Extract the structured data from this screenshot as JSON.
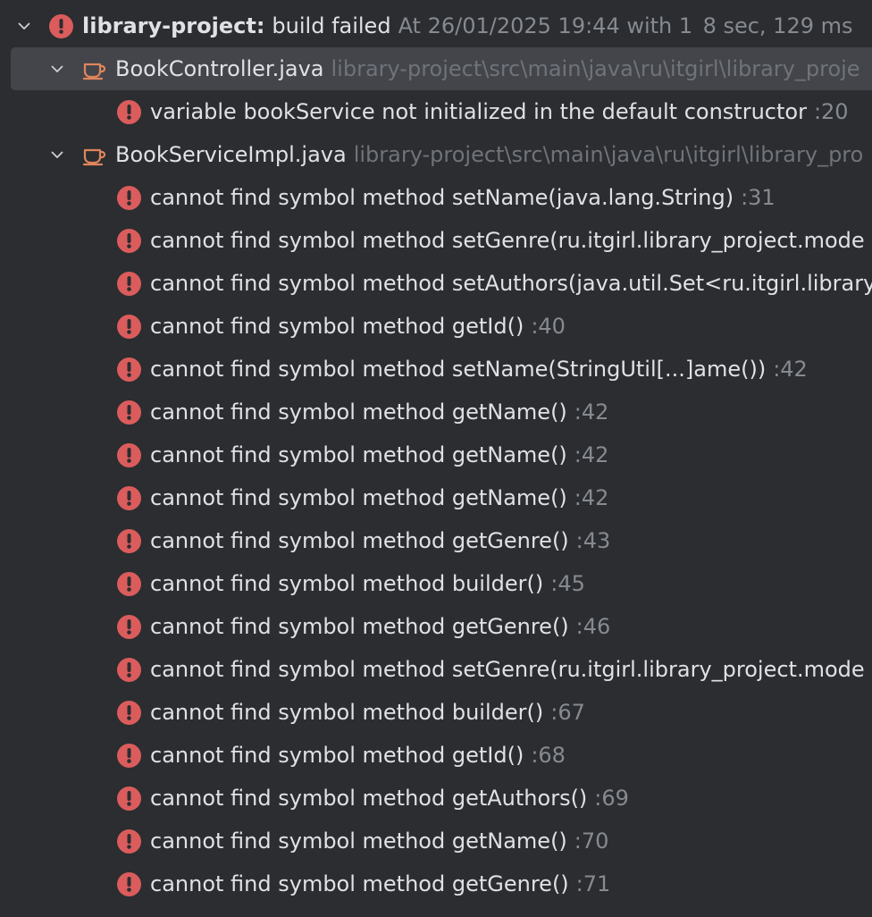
{
  "root": {
    "project": "library-project:",
    "status": "build failed",
    "detail": "At 26/01/2025 19:44 with 1",
    "duration": "8 sec, 129 ms"
  },
  "files": [
    {
      "name": "BookController.java",
      "path": "library-project\\src\\main\\java\\ru\\itgirl\\library_proje",
      "errors": [
        {
          "message": "variable bookService not initialized in the default constructor",
          "line": ":20"
        }
      ]
    },
    {
      "name": "BookServiceImpl.java",
      "path": "library-project\\src\\main\\java\\ru\\itgirl\\library_pro",
      "errors": [
        {
          "message": "cannot find symbol method setName(java.lang.String)",
          "line": ":31"
        },
        {
          "message": "cannot find symbol method setGenre(ru.itgirl.library_project.mode",
          "line": ""
        },
        {
          "message": "cannot find symbol method setAuthors(java.util.Set<ru.itgirl.library",
          "line": ""
        },
        {
          "message": "cannot find symbol method getId()",
          "line": ":40"
        },
        {
          "message": "cannot find symbol method setName(StringUtil[...]ame())",
          "line": ":42"
        },
        {
          "message": "cannot find symbol method getName()",
          "line": ":42"
        },
        {
          "message": "cannot find symbol method getName()",
          "line": ":42"
        },
        {
          "message": "cannot find symbol method getName()",
          "line": ":42"
        },
        {
          "message": "cannot find symbol method getGenre()",
          "line": ":43"
        },
        {
          "message": "cannot find symbol method builder()",
          "line": ":45"
        },
        {
          "message": "cannot find symbol method getGenre()",
          "line": ":46"
        },
        {
          "message": "cannot find symbol method setGenre(ru.itgirl.library_project.mode",
          "line": ""
        },
        {
          "message": "cannot find symbol method builder()",
          "line": ":67"
        },
        {
          "message": "cannot find symbol method getId()",
          "line": ":68"
        },
        {
          "message": "cannot find symbol method getAuthors()",
          "line": ":69"
        },
        {
          "message": "cannot find symbol method getName()",
          "line": ":70"
        },
        {
          "message": "cannot find symbol method getGenre()",
          "line": ":71"
        }
      ]
    }
  ],
  "colors": {
    "background": "#2b2d30",
    "selected_row": "#43454a",
    "error": "#db5c5c",
    "java_icon": "#e0855c",
    "text": "#dfe1e5",
    "muted": "#868a91"
  }
}
